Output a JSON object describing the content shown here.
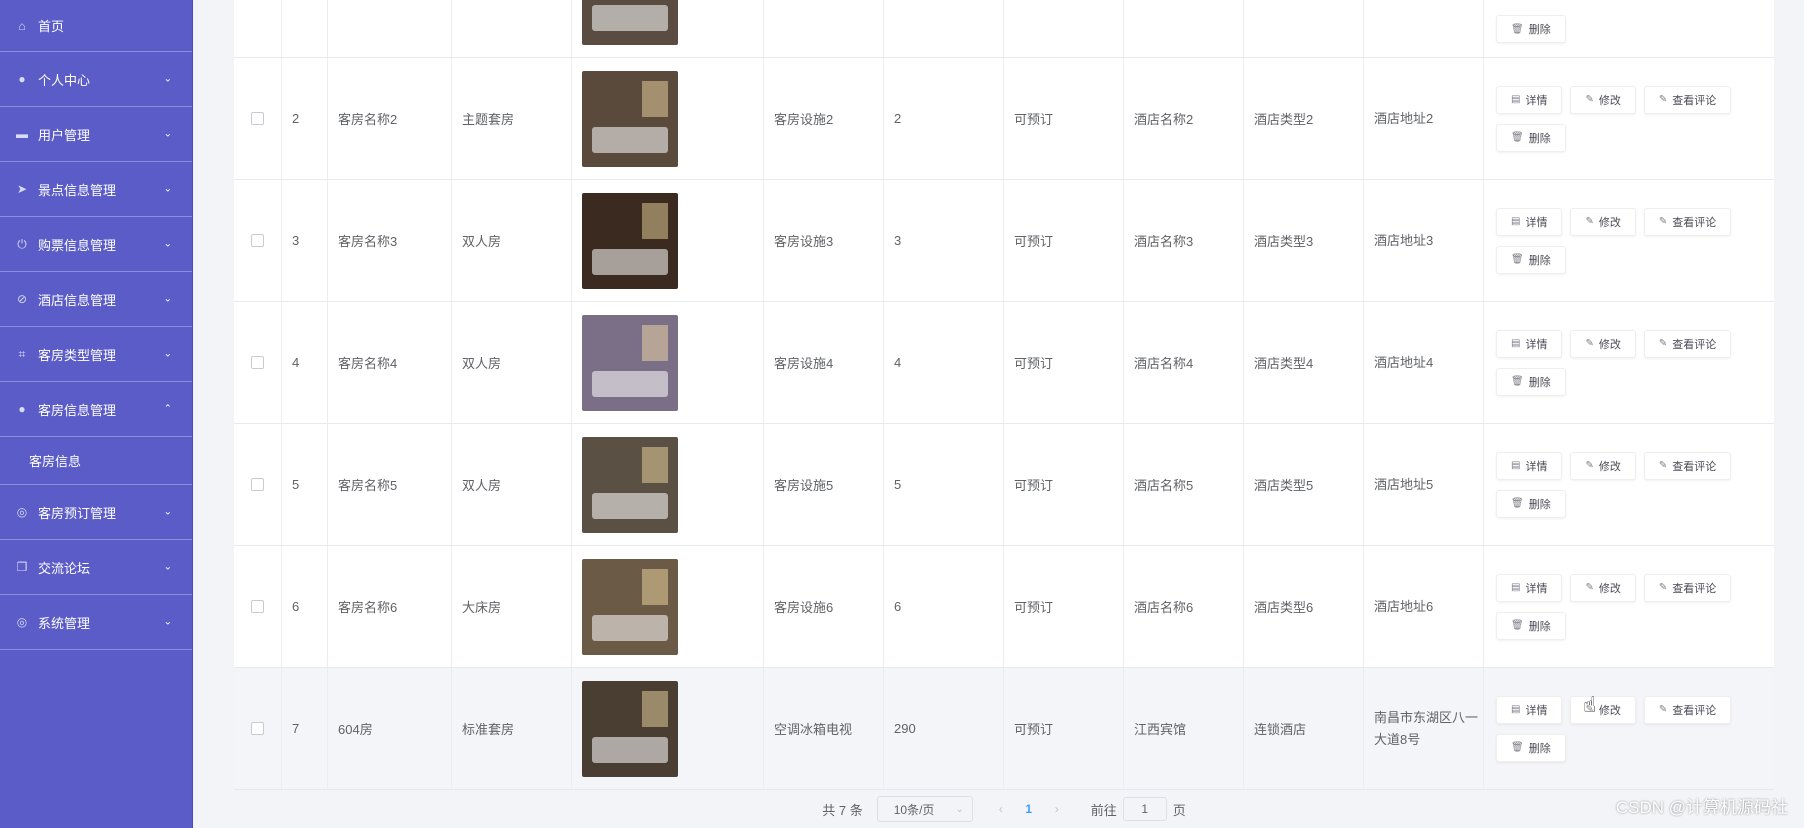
{
  "sidebar": {
    "items": [
      {
        "label": "首页",
        "icon": "home-icon",
        "chevron": ""
      },
      {
        "label": "个人中心",
        "icon": "user-icon",
        "chevron": "⌄"
      },
      {
        "label": "用户管理",
        "icon": "users-icon",
        "chevron": "⌄"
      },
      {
        "label": "景点信息管理",
        "icon": "send-icon",
        "chevron": "⌄"
      },
      {
        "label": "购票信息管理",
        "icon": "power-icon",
        "chevron": "⌄"
      },
      {
        "label": "酒店信息管理",
        "icon": "block-icon",
        "chevron": "⌄"
      },
      {
        "label": "客房类型管理",
        "icon": "crop-icon",
        "chevron": "⌄"
      },
      {
        "label": "客房信息管理",
        "icon": "user-icon",
        "chevron": "⌃"
      },
      {
        "label": "客房预订管理",
        "icon": "globe-icon",
        "chevron": "⌄"
      },
      {
        "label": "交流论坛",
        "icon": "copy-icon",
        "chevron": "⌄"
      },
      {
        "label": "系统管理",
        "icon": "globe-icon",
        "chevron": "⌄"
      }
    ],
    "sub_item": "客房信息"
  },
  "table": {
    "rows": [
      {
        "idx": "2",
        "name": "客房名称2",
        "type": "主题套房",
        "facility": "客房设施2",
        "price": "2",
        "status": "可预订",
        "hotel_name": "酒店名称2",
        "hotel_type": "酒店类型2",
        "hotel_addr": "酒店地址2",
        "img_color": "#5a4a3c"
      },
      {
        "idx": "3",
        "name": "客房名称3",
        "type": "双人房",
        "facility": "客房设施3",
        "price": "3",
        "status": "可预订",
        "hotel_name": "酒店名称3",
        "hotel_type": "酒店类型3",
        "hotel_addr": "酒店地址3",
        "img_color": "#3a2a20"
      },
      {
        "idx": "4",
        "name": "客房名称4",
        "type": "双人房",
        "facility": "客房设施4",
        "price": "4",
        "status": "可预订",
        "hotel_name": "酒店名称4",
        "hotel_type": "酒店类型4",
        "hotel_addr": "酒店地址4",
        "img_color": "#7a6f86"
      },
      {
        "idx": "5",
        "name": "客房名称5",
        "type": "双人房",
        "facility": "客房设施5",
        "price": "5",
        "status": "可预订",
        "hotel_name": "酒店名称5",
        "hotel_type": "酒店类型5",
        "hotel_addr": "酒店地址5",
        "img_color": "#5b5044"
      },
      {
        "idx": "6",
        "name": "客房名称6",
        "type": "大床房",
        "facility": "客房设施6",
        "price": "6",
        "status": "可预订",
        "hotel_name": "酒店名称6",
        "hotel_type": "酒店类型6",
        "hotel_addr": "酒店地址6",
        "img_color": "#6b5a45"
      },
      {
        "idx": "7",
        "name": "604房",
        "type": "标准套房",
        "facility": "空调冰箱电视",
        "price": "290",
        "status": "可预订",
        "hotel_name": "江西宾馆",
        "hotel_type": "连锁酒店",
        "hotel_addr": "南昌市东湖区八一大道8号",
        "img_color": "#4a3e33"
      }
    ],
    "partial_row_img_color": "#5a4c40"
  },
  "actions": {
    "detail": "详情",
    "edit": "修改",
    "comments": "查看评论",
    "delete": "删除"
  },
  "pagination": {
    "total": "共 7 条",
    "page_size": "10条/页",
    "current_page": "1",
    "goto_label": "前往",
    "goto_value": "1",
    "page_unit": "页"
  },
  "watermark": "CSDN @计算机源码社",
  "colors": {
    "sidebar": "#5b5cc7",
    "accent": "#409eff"
  }
}
